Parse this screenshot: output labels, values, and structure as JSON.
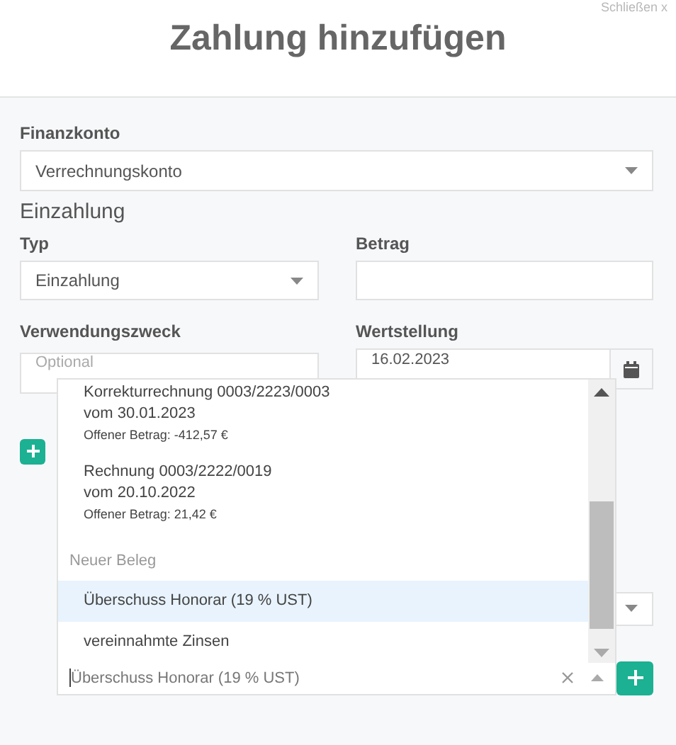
{
  "close_link": "Schließen x",
  "title": "Zahlung hinzufügen",
  "finanzkonto": {
    "label": "Finanzkonto",
    "value": "Verrechnungskonto"
  },
  "section": "Einzahlung",
  "typ": {
    "label": "Typ",
    "value": "Einzahlung"
  },
  "betrag": {
    "label": "Betrag"
  },
  "verwendungszweck": {
    "label": "Verwendungszweck",
    "placeholder": "Optional"
  },
  "wertstellung": {
    "label": "Wertstellung",
    "value": "16.02.2023"
  },
  "dropdown": {
    "options": [
      {
        "kind": "document",
        "name": "Korrekturrechnung 0003/2223/0003",
        "date": "vom 30.01.2023",
        "note": "Offener Betrag: -412,57 €",
        "selected": false
      },
      {
        "kind": "document",
        "name": "Rechnung 0003/2222/0019",
        "date": "vom 20.10.2022",
        "note": "Offener Betrag: 21,42 €",
        "selected": false
      },
      {
        "kind": "group",
        "label": "Neuer Beleg"
      },
      {
        "kind": "option",
        "label": "Überschuss Honorar (19 % UST)",
        "selected": true
      },
      {
        "kind": "option",
        "label": "vereinnahmte Zinsen",
        "selected": false
      }
    ]
  },
  "combobox": {
    "value": "Überschuss Honorar (19 % UST)"
  }
}
